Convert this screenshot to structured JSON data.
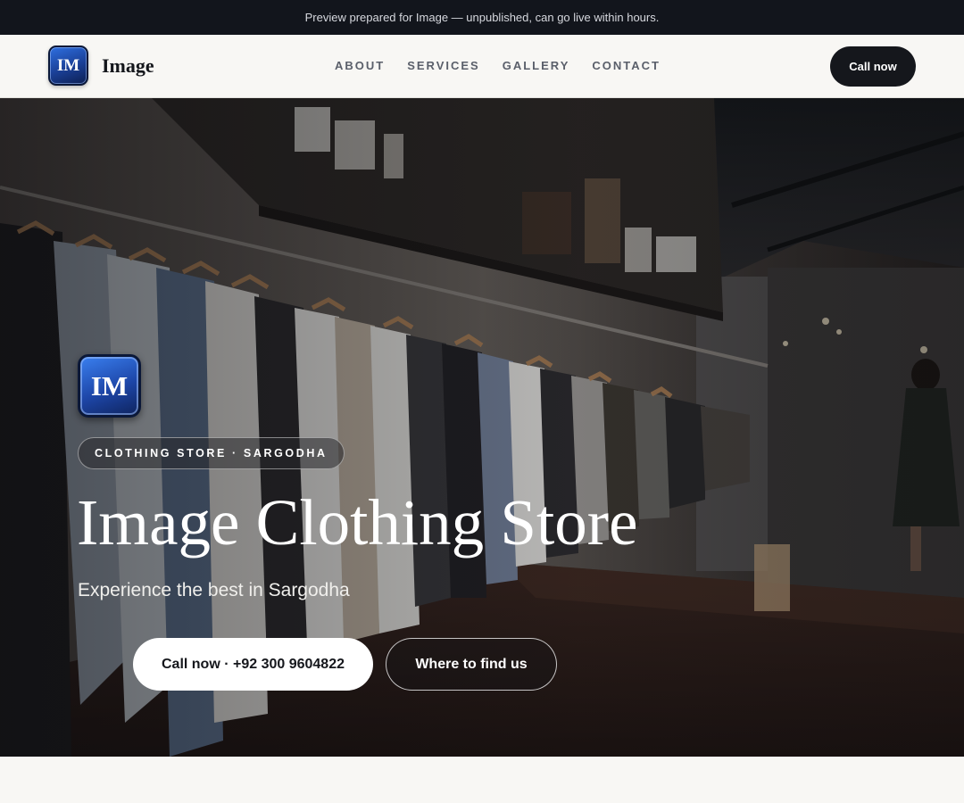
{
  "preview_bar": {
    "text": "Preview prepared for Image — unpublished, can go live within hours."
  },
  "header": {
    "logo_initials": "IM",
    "brand_name": "Image",
    "nav": [
      {
        "label": "ABOUT"
      },
      {
        "label": "SERVICES"
      },
      {
        "label": "GALLERY"
      },
      {
        "label": "CONTACT"
      }
    ],
    "cta_label": "Call now"
  },
  "hero": {
    "logo_initials": "IM",
    "eyebrow": "CLOTHING STORE · SARGODHA",
    "title": "Image Clothing Store",
    "subtitle": "Experience the best in Sargodha",
    "primary_button": "Call now · +92 300 9604822",
    "secondary_button": "Where to find us",
    "background_image": "clothing-store-interior-photo"
  },
  "colors": {
    "preview_bar_bg": "#12151c",
    "header_bg": "#f8f7f4",
    "dark_button": "#15171c",
    "logo_blue": "#1d46a8"
  }
}
